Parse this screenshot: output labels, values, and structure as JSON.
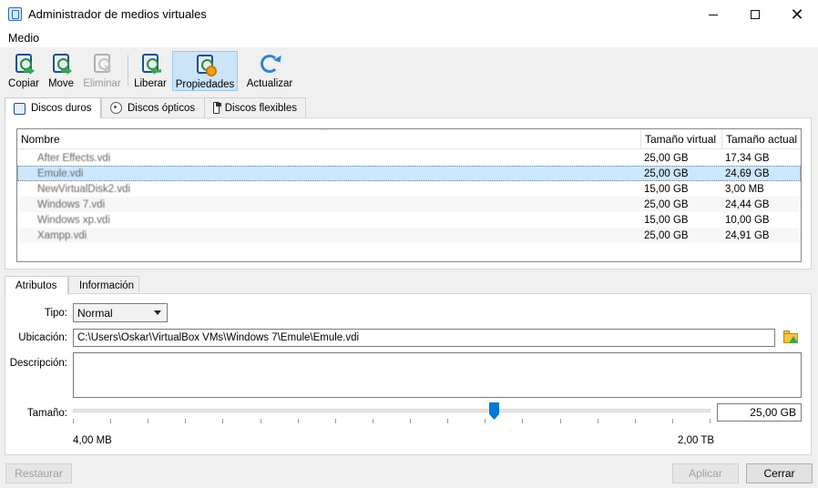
{
  "window": {
    "title": "Administrador de medios virtuales",
    "minimize": "—",
    "close": "✕"
  },
  "menu": {
    "items": [
      {
        "label": "Medio",
        "mnemonic": "M"
      }
    ]
  },
  "toolbar": {
    "buttons": [
      {
        "label": "Copiar",
        "icon": "copy-disk-icon",
        "enabled": true
      },
      {
        "label": "Move",
        "icon": "move-disk-icon",
        "enabled": true
      },
      {
        "label": "Eliminar",
        "icon": "remove-disk-icon",
        "enabled": false
      },
      {
        "label": "Liberar",
        "icon": "release-disk-icon",
        "enabled": true
      },
      {
        "label": "Propiedades",
        "icon": "properties-disk-icon",
        "enabled": true,
        "pressed": true
      },
      {
        "label": "Actualizar",
        "icon": "refresh-icon",
        "enabled": true
      }
    ]
  },
  "media_tabs": [
    {
      "label": "Discos duros",
      "active": true,
      "icon": "hard-disk-icon"
    },
    {
      "label": "Discos ópticos",
      "active": false,
      "icon": "optical-disk-icon"
    },
    {
      "label": "Discos flexibles",
      "active": false,
      "icon": "floppy-disk-icon"
    }
  ],
  "table": {
    "columns": [
      "Nombre",
      "Tamaño virtual",
      "Tamaño actual"
    ],
    "sort_indicator": "^",
    "rows": [
      {
        "name": "After Effects.vdi",
        "virtual": "25,00 GB",
        "actual": "17,34 GB",
        "selected": false
      },
      {
        "name": "Emule.vdi",
        "virtual": "25,00 GB",
        "actual": "24,69 GB",
        "selected": true
      },
      {
        "name": "NewVirtualDisk2.vdi",
        "virtual": "15,00 GB",
        "actual": "3,00 MB",
        "selected": false
      },
      {
        "name": "Windows 7.vdi",
        "virtual": "25,00 GB",
        "actual": "24,44 GB",
        "selected": false
      },
      {
        "name": "Windows xp.vdi",
        "virtual": "15,00 GB",
        "actual": "10,00 GB",
        "selected": false
      },
      {
        "name": "Xampp.vdi",
        "virtual": "25,00 GB",
        "actual": "24,91 GB",
        "selected": false
      }
    ]
  },
  "detail_tabs": [
    {
      "label": "Atributos",
      "active": true
    },
    {
      "label": "Información",
      "active": false
    }
  ],
  "attributes": {
    "type_label": "Tipo:",
    "type_value": "Normal",
    "location_label": "Ubicación:",
    "location_value": "C:\\Users\\Oskar\\VirtualBox VMs\\Windows 7\\Emule\\Emule.vdi",
    "description_label": "Descripción:",
    "description_value": "",
    "size_label": "Tamaño:",
    "size_value": "25,00 GB",
    "size_min": "4,00 MB",
    "size_max": "2,00 TB",
    "slider_fraction": 0.66
  },
  "footer": {
    "reset": "Restaurar",
    "apply": "Aplicar",
    "close": "Cerrar"
  }
}
